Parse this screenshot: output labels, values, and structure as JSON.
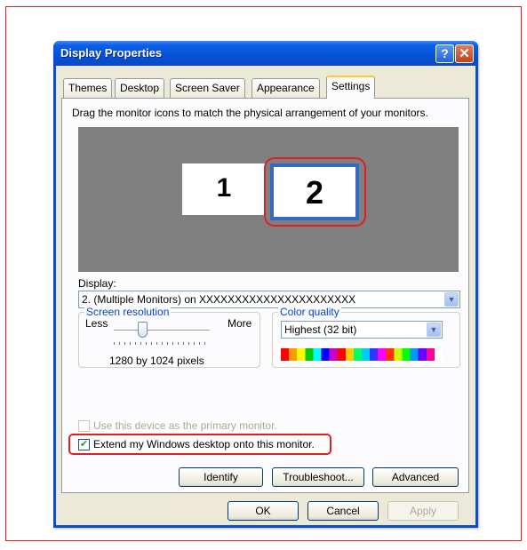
{
  "window": {
    "title": "Display Properties",
    "help_icon_glyph": "?",
    "close_icon_glyph": "✕"
  },
  "tabs": [
    {
      "label": "Themes",
      "active": false
    },
    {
      "label": "Desktop",
      "active": false
    },
    {
      "label": "Screen Saver",
      "active": false
    },
    {
      "label": "Appearance",
      "active": false
    },
    {
      "label": "Settings",
      "active": true
    }
  ],
  "settings": {
    "instruction": "Drag the monitor icons to match the physical arrangement of your monitors.",
    "monitors": [
      {
        "number": "1",
        "selected": false
      },
      {
        "number": "2",
        "selected": true
      }
    ],
    "display_label": "Display:",
    "display_value": "2. (Multiple Monitors) on  XXXXXXXXXXXXXXXXXXXXXX",
    "screen_resolution": {
      "title": "Screen resolution",
      "less": "Less",
      "more": "More",
      "value": "1280 by 1024 pixels",
      "slider_fraction": 0.3
    },
    "color_quality": {
      "title": "Color quality",
      "value": "Highest (32 bit)"
    },
    "primary_checkbox": {
      "label": "Use this device as the primary monitor.",
      "checked": false,
      "enabled": false
    },
    "extend_checkbox": {
      "label": "Extend my Windows desktop onto this monitor.",
      "checked": true,
      "enabled": true
    },
    "buttons": {
      "identify": "Identify",
      "troubleshoot": "Troubleshoot...",
      "advanced": "Advanced"
    }
  },
  "dialog_buttons": {
    "ok": "OK",
    "cancel": "Cancel",
    "apply": "Apply",
    "apply_enabled": false
  },
  "colors": {
    "title_bar": "#0552d6",
    "highlight": "#e02020",
    "monitor_area": "#808080",
    "group_title": "#0046d5"
  }
}
